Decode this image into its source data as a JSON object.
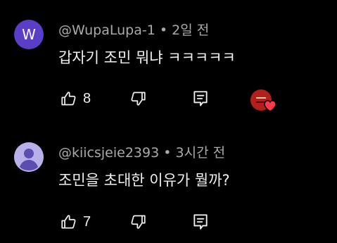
{
  "comments": [
    {
      "avatar_initial": "W",
      "avatar_color": "#5b3ec6",
      "author": "@WupaLupa-1",
      "separator": "•",
      "time": "2일 전",
      "text": "갑자기 조민 뭐냐 ㅋㅋㅋㅋㅋ",
      "likes": "8",
      "creator_heart": true,
      "heart_color": "#ff3a4a"
    },
    {
      "avatar_initial": "",
      "avatar_color": "#b8b0e8",
      "author": "@kiicsjeie2393",
      "separator": "•",
      "time": "3시간 전",
      "text": "조민을 초대한 이유가 뭘까?",
      "likes": "7",
      "creator_heart": false
    }
  ],
  "icons": {
    "like": "thumbs-up-icon",
    "dislike": "thumbs-down-icon",
    "reply": "reply-comment-icon"
  }
}
